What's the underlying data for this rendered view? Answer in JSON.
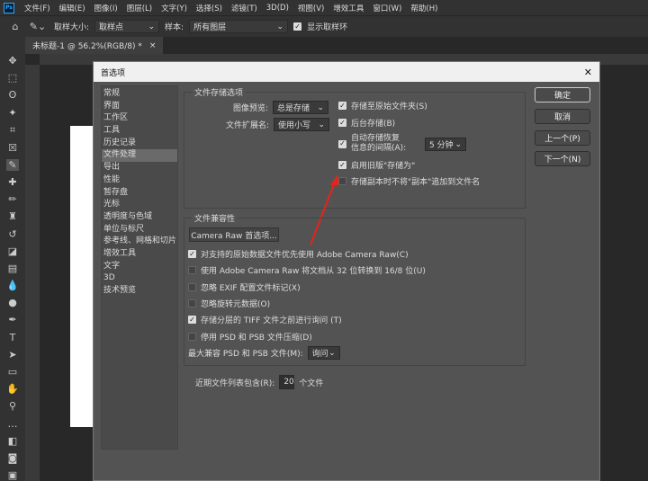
{
  "menubar": {
    "logo": "Ps",
    "items": [
      "文件(F)",
      "编辑(E)",
      "图像(I)",
      "图层(L)",
      "文字(Y)",
      "选择(S)",
      "滤镜(T)",
      "3D(D)",
      "视图(V)",
      "增效工具",
      "窗口(W)",
      "帮助(H)"
    ]
  },
  "options": {
    "sample_size_label": "取样大小:",
    "sample_size": "取样点",
    "sample_label": "样本:",
    "sample": "所有图层",
    "show_ring": "显示取样环"
  },
  "doc_tab": {
    "title": "未标题-1 @ 56.2%(RGB/8) *",
    "close": "×"
  },
  "dialog": {
    "title": "首选项",
    "close": "✕",
    "sidebar": [
      "常规",
      "界面",
      "工作区",
      "工具",
      "历史记录",
      "文件处理",
      "导出",
      "性能",
      "暂存盘",
      "光标",
      "透明度与色域",
      "单位与标尺",
      "参考线、网格和切片",
      "增效工具",
      "文字",
      "3D",
      "技术预览"
    ],
    "active_index": 5,
    "buttons": {
      "ok": "确定",
      "cancel": "取消",
      "prev": "上一个(P)",
      "next": "下一个(N)"
    },
    "save_group": {
      "title": "文件存储选项",
      "preview_label": "图像预览:",
      "preview": "总是存储",
      "ext_label": "文件扩展名:",
      "ext": "使用小写",
      "checks": [
        {
          "label": "存储至原始文件夹(S)",
          "checked": true
        },
        {
          "label": "后台存储(B)",
          "checked": true
        },
        {
          "label": "自动存储恢复",
          "label2": "信息的间隔(A):",
          "checked": true
        },
        {
          "label": "启用旧版\"存储为\"",
          "checked": true
        },
        {
          "label": "存储副本时不将\"副本\"追加到文件名",
          "checked": false
        }
      ],
      "interval": "5 分钟"
    },
    "compat_group": {
      "title": "文件兼容性",
      "camera_raw_button": "Camera Raw 首选项...",
      "checks": [
        {
          "label": "对支持的原始数据文件优先使用 Adobe Camera Raw(C)",
          "checked": true
        },
        {
          "label": "使用 Adobe Camera Raw 将文档从 32 位转换到 16/8 位(U)",
          "checked": false
        },
        {
          "label": "忽略 EXIF 配置文件标记(X)",
          "checked": false
        },
        {
          "label": "忽略旋转元数据(O)",
          "checked": false
        },
        {
          "label": "存储分层的 TIFF 文件之前进行询问 (T)",
          "checked": true
        },
        {
          "label": "停用 PSD 和 PSB 文件压缩(D)",
          "checked": false
        }
      ],
      "max_compat_label": "最大兼容 PSD 和 PSB 文件(M):",
      "max_compat": "询问"
    },
    "recent_label": "近期文件列表包含(R):",
    "recent_value": "20",
    "recent_suffix": "个文件"
  }
}
